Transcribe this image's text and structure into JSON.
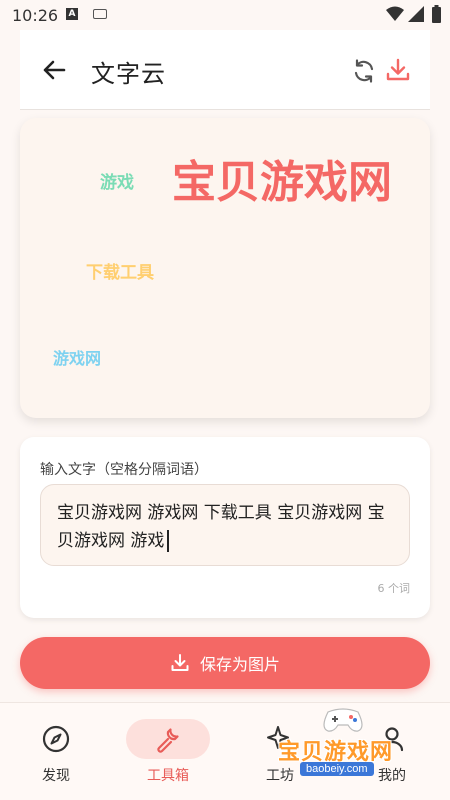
{
  "status_bar": {
    "time": "10:26",
    "notif_letter": "A"
  },
  "header": {
    "title": "文字云"
  },
  "word_cloud": {
    "words": [
      {
        "text": "宝贝游戏网",
        "color": "#f46865"
      },
      {
        "text": "游戏",
        "color": "#7bdcb5"
      },
      {
        "text": "下载工具",
        "color": "#ffcf70"
      },
      {
        "text": "游戏网",
        "color": "#7fd2f0"
      }
    ]
  },
  "input": {
    "label": "输入文字（空格分隔词语）",
    "value": "宝贝游戏网 游戏网 下载工具 宝贝游戏网 宝贝游戏网 游戏",
    "word_count": "6 个词"
  },
  "save_button": {
    "label": "保存为图片"
  },
  "bottom_nav": {
    "items": [
      {
        "label": "发现",
        "icon": "compass-icon",
        "active": false
      },
      {
        "label": "工具箱",
        "icon": "wrench-icon",
        "active": true
      },
      {
        "label": "工坊",
        "icon": "sparkle-icon",
        "active": false
      },
      {
        "label": "我的",
        "icon": "person-icon",
        "active": false
      }
    ]
  },
  "watermark": {
    "text": "宝贝游戏网",
    "url": "baobeiy.com"
  },
  "colors": {
    "accent": "#f46865",
    "background": "#fdf7f4"
  }
}
